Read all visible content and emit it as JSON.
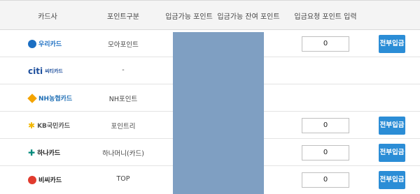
{
  "header": {
    "card_company": "카드사",
    "point_type": "포인트구분",
    "available_points": "입금가능 포인트",
    "remaining_points": "입금가능 잔여 포인트",
    "request_input": "입금요청 포인트 입력"
  },
  "rows": [
    {
      "card": "우리카드",
      "point_type": "모아포인트",
      "input_value": "0",
      "button": "전부입금",
      "color": "#1b6ec2"
    },
    {
      "card": "씨티카드",
      "point_type": "-",
      "color": "#1d4e9c"
    },
    {
      "card": "NH농협카드",
      "point_type": "NH포인트",
      "color": "#f4a400"
    },
    {
      "card": "KB국민카드",
      "point_type": "포인트리",
      "input_value": "0",
      "button": "전부입금",
      "color": "#f2b600"
    },
    {
      "card": "하나카드",
      "point_type": "하나머니(카드)",
      "input_value": "0",
      "button": "전부입금",
      "color": "#00897b"
    },
    {
      "card": "비씨카드",
      "point_type": "TOP",
      "input_value": "0",
      "button": "전부입금",
      "color": "#e13b2e"
    }
  ],
  "colors": {
    "button": "#2b8dd6",
    "mask": "#7f9fc2"
  }
}
